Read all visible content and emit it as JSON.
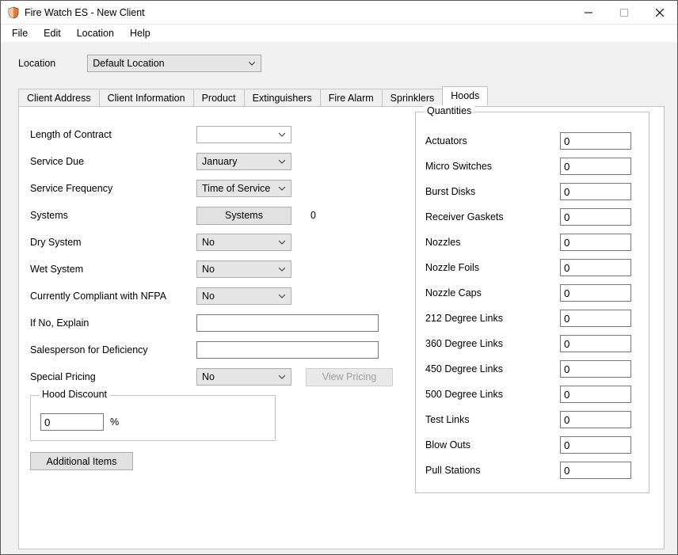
{
  "window": {
    "title": "Fire Watch ES - New Client"
  },
  "menu": {
    "file": "File",
    "edit": "Edit",
    "location": "Location",
    "help": "Help"
  },
  "location_bar": {
    "label": "Location",
    "selected": "Default Location"
  },
  "tabs": {
    "client_address": "Client Address",
    "client_information": "Client Information",
    "product": "Product",
    "extinguishers": "Extinguishers",
    "fire_alarm": "Fire Alarm",
    "sprinklers": "Sprinklers",
    "hoods": "Hoods"
  },
  "form": {
    "length_of_contract": {
      "label": "Length of Contract",
      "value": ""
    },
    "service_due": {
      "label": "Service Due",
      "value": "January"
    },
    "service_frequency": {
      "label": "Service Frequency",
      "value": "Time of Service"
    },
    "systems": {
      "label": "Systems",
      "button": "Systems",
      "count": "0"
    },
    "dry_system": {
      "label": "Dry System",
      "value": "No"
    },
    "wet_system": {
      "label": "Wet System",
      "value": "No"
    },
    "compliant": {
      "label": "Currently Compliant with NFPA",
      "value": "No"
    },
    "if_no": {
      "label": "If No, Explain",
      "value": ""
    },
    "salesperson": {
      "label": "Salesperson for Deficiency",
      "value": ""
    },
    "special_pricing": {
      "label": "Special Pricing",
      "value": "No",
      "view_button": "View Pricing"
    },
    "hood_discount": {
      "legend": "Hood Discount",
      "value": "0",
      "pct": "%"
    },
    "additional_items": "Additional Items"
  },
  "quantities": {
    "legend": "Quantities",
    "rows": [
      {
        "label": "Actuators",
        "value": "0"
      },
      {
        "label": "Micro Switches",
        "value": "0"
      },
      {
        "label": "Burst Disks",
        "value": "0"
      },
      {
        "label": "Receiver Gaskets",
        "value": "0"
      },
      {
        "label": "Nozzles",
        "value": "0"
      },
      {
        "label": "Nozzle Foils",
        "value": "0"
      },
      {
        "label": "Nozzle Caps",
        "value": "0"
      },
      {
        "label": "212 Degree Links",
        "value": "0"
      },
      {
        "label": "360 Degree Links",
        "value": "0"
      },
      {
        "label": "450 Degree Links",
        "value": "0"
      },
      {
        "label": "500 Degree Links",
        "value": "0"
      },
      {
        "label": "Test Links",
        "value": "0"
      },
      {
        "label": "Blow Outs",
        "value": "0"
      },
      {
        "label": "Pull Stations",
        "value": "0"
      }
    ]
  }
}
